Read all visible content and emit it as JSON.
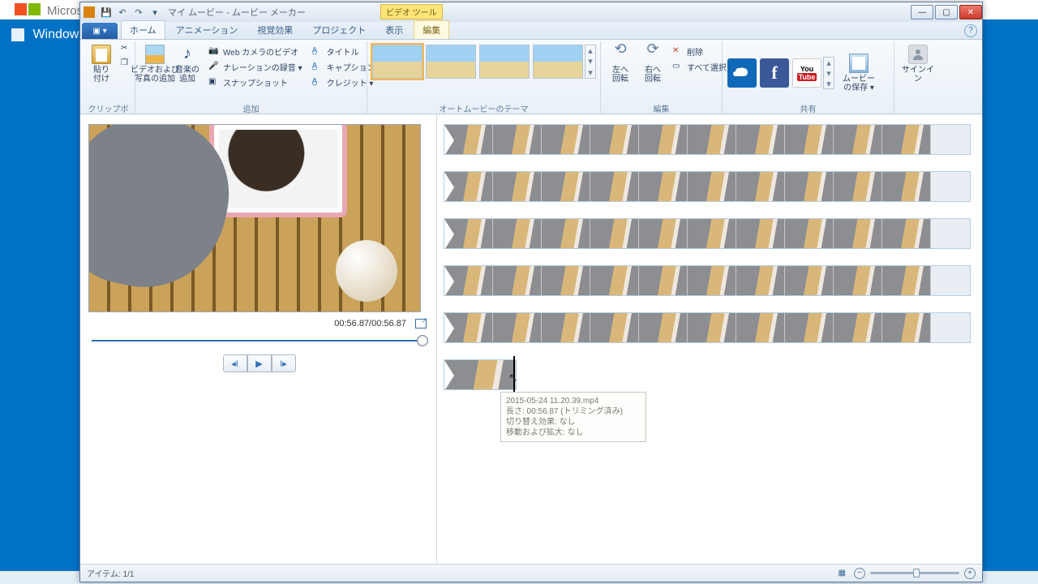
{
  "bg": {
    "brand": "Microsoft",
    "band": "Windows"
  },
  "title": "マイ ムービー - ムービー メーカー",
  "context_tab": "ビデオ ツール",
  "tabs": {
    "file": "▣ ▾",
    "home": "ホーム",
    "anim": "アニメーション",
    "vfx": "視覚効果",
    "project": "プロジェクト",
    "view": "表示",
    "edit": "編集"
  },
  "groups": {
    "clipboard": "クリップボード",
    "add": "追加",
    "automovie": "オートムービーのテーマ",
    "edit": "編集",
    "share": "共有"
  },
  "btn": {
    "paste": "貼り\n付け",
    "addmedia": "ビデオおよび\n写真の追加",
    "addmusic": "音楽の\n追加",
    "webcam": "Web カメラのビデオ",
    "narration": "ナレーションの録音 ▾",
    "snapshot": "スナップショット",
    "title": "タイトル",
    "caption": "キャプション",
    "credits": "クレジット ▾",
    "rotL": "左へ\n回転",
    "rotR": "右へ\n回転",
    "delete": "削除",
    "selectall": "すべて選択",
    "savemovie": "ムービー\nの保存 ▾",
    "signin": "サインイン"
  },
  "share": {
    "yt": "You\nTube"
  },
  "timecode": "00:56.87/00:56.87",
  "status": {
    "items": "アイテム: 1/1"
  },
  "tooltip": {
    "l1": "2015-05-24 11.20.39.mp4",
    "l2": "長さ: 00:56.87 (トリミング済み)",
    "l3": "切り替え効果: なし",
    "l4": "移動および拡大: なし"
  },
  "icons": {
    "cut": "✂",
    "copy": "❐",
    "brush": "✎",
    "x": "✕",
    "sel": "▭"
  }
}
